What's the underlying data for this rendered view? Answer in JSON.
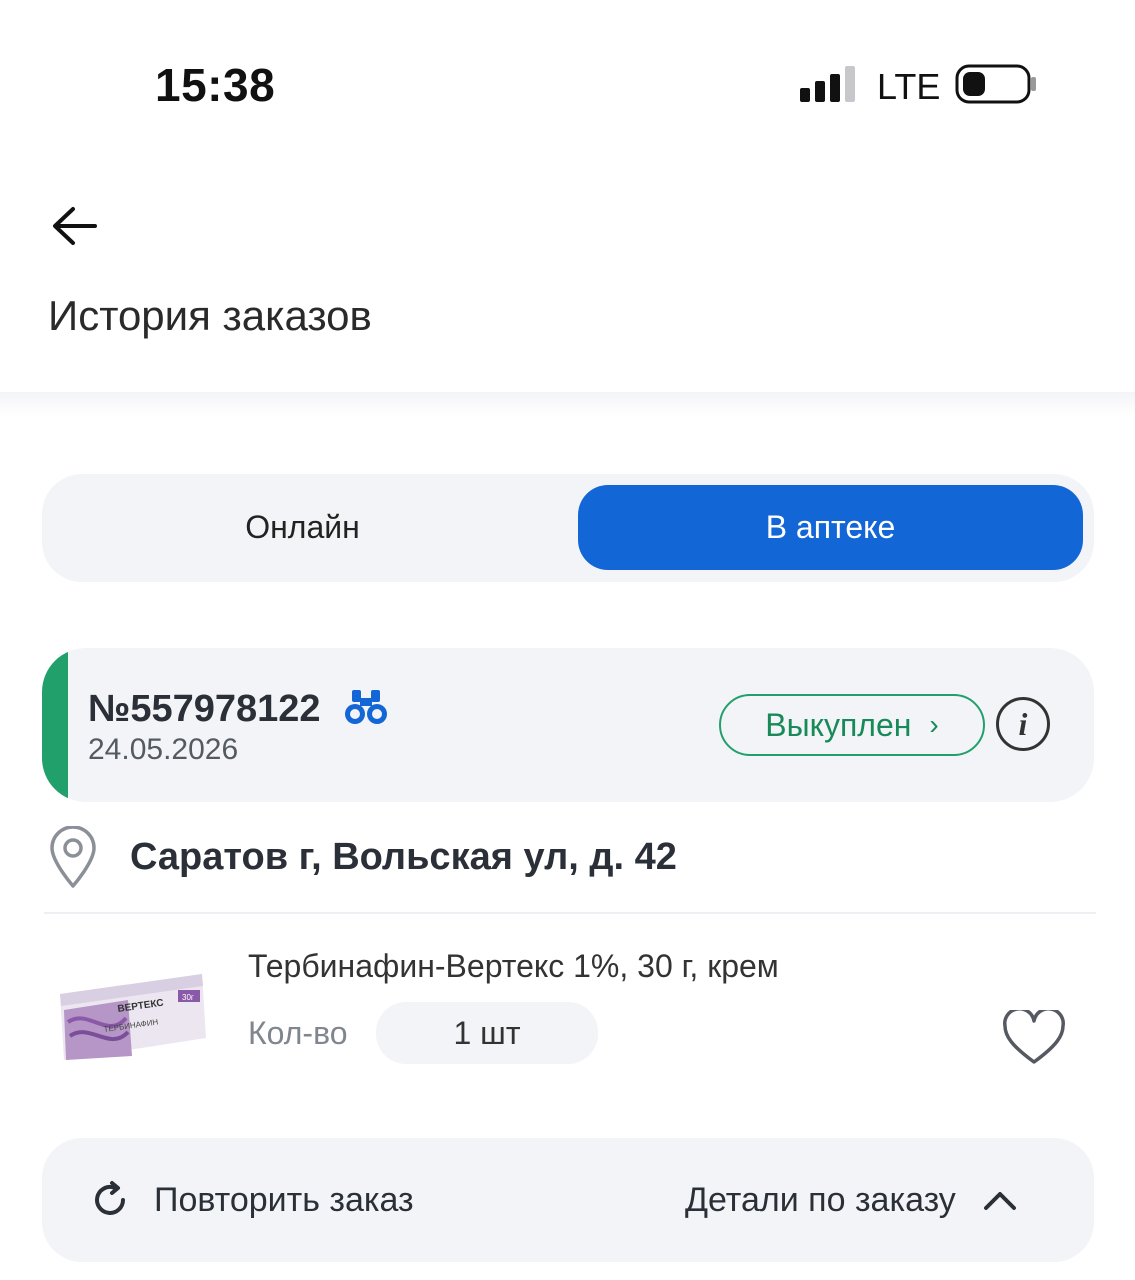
{
  "status_bar": {
    "time": "15:38",
    "network": "LTE",
    "icons": [
      "signal-icon",
      "battery-icon"
    ]
  },
  "header": {
    "back_icon": "arrow-left-icon",
    "title": "История заказов"
  },
  "tabs": [
    {
      "label": "Онлайн",
      "active": false
    },
    {
      "label": "В аптеке",
      "active": true
    }
  ],
  "order": {
    "number": "№557978122",
    "date": "24.05.2026",
    "status": "Выкуплен",
    "status_color": "#21a06b",
    "icons": [
      "binoculars-icon",
      "info-icon"
    ]
  },
  "address": {
    "text": "Саратов г, Вольская ул, д. 42",
    "icon": "location-pin-icon"
  },
  "product": {
    "name": "Тербинафин-Вертекс 1%, 30 г, крем",
    "qty_label": "Кол-во",
    "qty_value": "1 шт",
    "package": {
      "brand": "ВЕРТЕКС",
      "drug": "ТЕРБИНАФИН",
      "size": "30г"
    }
  },
  "actions": {
    "repeat_label": "Повторить заказ",
    "details_label": "Детали по заказу"
  },
  "colors": {
    "accent_blue": "#1366d6",
    "accent_green": "#21a06b",
    "surface": "#f3f4f7"
  }
}
